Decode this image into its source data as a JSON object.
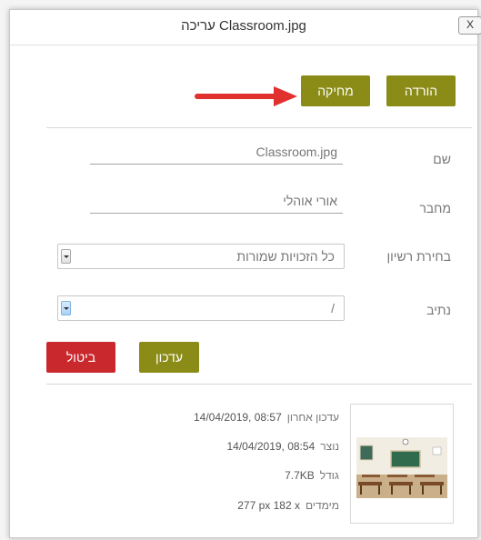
{
  "dialog": {
    "title": "עריכה Classroom.jpg",
    "close_label": "X"
  },
  "actions": {
    "download_label": "הורדה",
    "delete_label": "מחיקה"
  },
  "fields": {
    "name_label": "שם",
    "name_value": "Classroom.jpg",
    "author_label": "מחבר",
    "author_value": "אורי אוהלי",
    "license_label": "בחירת רשיון",
    "license_value": "כל הזכויות שמורות",
    "path_label": "נתיב",
    "path_value": "/"
  },
  "form_buttons": {
    "update_label": "עדכון",
    "cancel_label": "ביטול"
  },
  "file_info": {
    "last_modified_label": "עדכון אחרון",
    "last_modified_value": "14/04/2019, 08:57",
    "created_label": "נוצר",
    "created_value": "14/04/2019, 08:54",
    "size_label": "גודל",
    "size_value": "7.7KB",
    "dimensions_label": "מימדים",
    "dimensions_value": "277 px 182 x"
  },
  "colors": {
    "olive": "#8b8c17",
    "red": "#c9282d",
    "arrow": "#e0312f"
  }
}
